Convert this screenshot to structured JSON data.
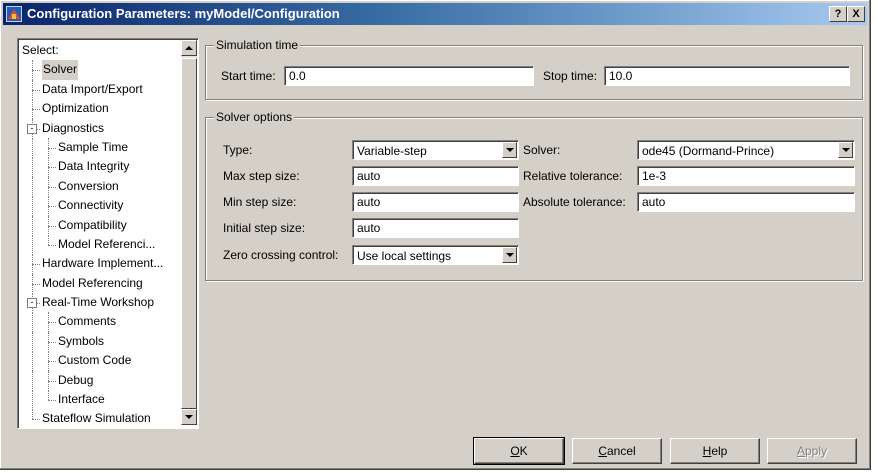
{
  "window": {
    "title": "Configuration Parameters: myModel/Configuration",
    "help_button": "?",
    "close_button": "X"
  },
  "tree": {
    "header": "Select:",
    "items": [
      {
        "label": "Solver",
        "level": 1,
        "selected": true
      },
      {
        "label": "Data Import/Export",
        "level": 1
      },
      {
        "label": "Optimization",
        "level": 1
      },
      {
        "label": "Diagnostics",
        "level": 1,
        "expander": "-"
      },
      {
        "label": "Sample Time",
        "level": 2
      },
      {
        "label": "Data Integrity",
        "level": 2
      },
      {
        "label": "Conversion",
        "level": 2
      },
      {
        "label": "Connectivity",
        "level": 2
      },
      {
        "label": "Compatibility",
        "level": 2
      },
      {
        "label": "Model Referenci...",
        "level": 2
      },
      {
        "label": "Hardware Implement...",
        "level": 1
      },
      {
        "label": "Model Referencing",
        "level": 1
      },
      {
        "label": "Real-Time Workshop",
        "level": 1,
        "expander": "-"
      },
      {
        "label": "Comments",
        "level": 2
      },
      {
        "label": "Symbols",
        "level": 2
      },
      {
        "label": "Custom Code",
        "level": 2
      },
      {
        "label": "Debug",
        "level": 2
      },
      {
        "label": "Interface",
        "level": 2
      },
      {
        "label": "Stateflow Simulation",
        "level": 1
      }
    ]
  },
  "simulation_time": {
    "title": "Simulation time",
    "start_label": "Start time:",
    "start_value": "0.0",
    "stop_label": "Stop time:",
    "stop_value": "10.0"
  },
  "solver_options": {
    "title": "Solver options",
    "type_label": "Type:",
    "type_value": "Variable-step",
    "max_step_label": "Max step size:",
    "max_step_value": "auto",
    "min_step_label": "Min step size:",
    "min_step_value": "auto",
    "initial_step_label": "Initial step size:",
    "initial_step_value": "auto",
    "zero_crossing_label": "Zero crossing control:",
    "zero_crossing_value": "Use local settings",
    "solver_label": "Solver:",
    "solver_value": "ode45 (Dormand-Prince)",
    "rel_tol_label": "Relative tolerance:",
    "rel_tol_value": "1e-3",
    "abs_tol_label": "Absolute tolerance:",
    "abs_tol_value": "auto"
  },
  "buttons": {
    "ok": {
      "mnemonic": "O",
      "rest": "K"
    },
    "cancel": {
      "mnemonic": "C",
      "rest": "ancel"
    },
    "help": {
      "mnemonic": "H",
      "rest": "elp"
    },
    "apply": {
      "mnemonic": "A",
      "rest": "pply"
    }
  },
  "colors": {
    "titlebar_start": "#0a246a",
    "titlebar_end": "#a6caf0",
    "face": "#d4d0c8"
  }
}
